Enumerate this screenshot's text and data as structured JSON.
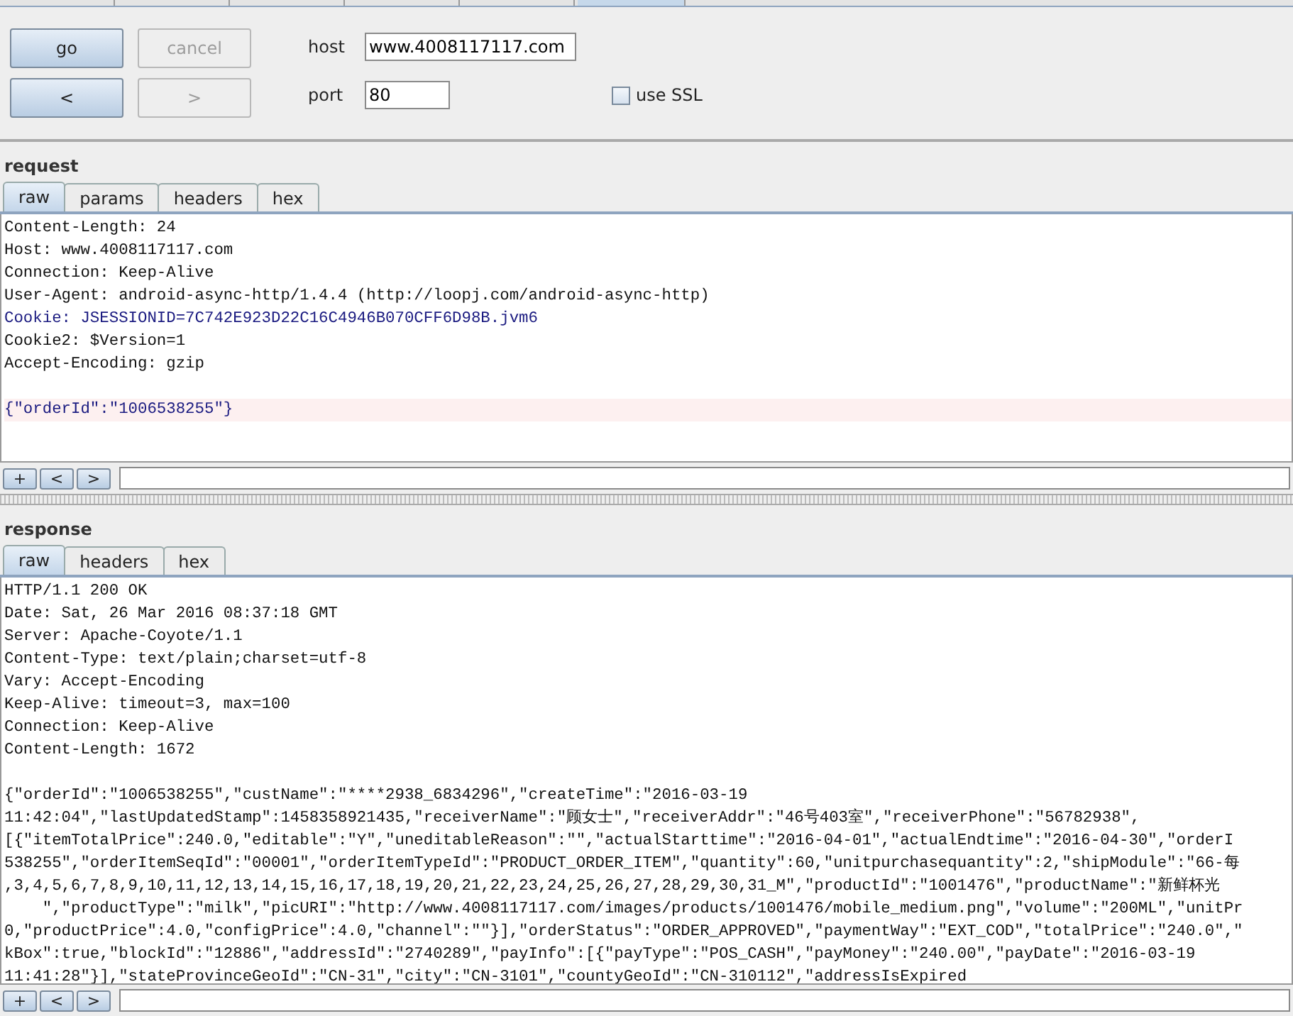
{
  "connection": {
    "buttons": [
      {
        "label": "go",
        "disabled": false
      },
      {
        "label": "cancel",
        "disabled": true
      },
      {
        "label": "<",
        "disabled": false
      },
      {
        "label": ">",
        "disabled": true
      }
    ],
    "host": {
      "label": "host",
      "value": "www.4008117117.com"
    },
    "port": {
      "label": "port",
      "value": "80"
    },
    "ssl": {
      "label": "use SSL",
      "checked": false
    }
  },
  "request": {
    "title": "request",
    "tabs": [
      {
        "label": "raw",
        "selected": true
      },
      {
        "label": "params",
        "selected": false
      },
      {
        "label": "headers",
        "selected": false
      },
      {
        "label": "hex",
        "selected": false
      }
    ],
    "lines": [
      {
        "text": "Content-Length: 24"
      },
      {
        "text": "Host: www.4008117117.com"
      },
      {
        "text": "Connection: Keep-Alive"
      },
      {
        "text": "User-Agent: android-async-http/1.4.4 (http://loopj.com/android-async-http)"
      },
      {
        "kind": "cookie",
        "text": "Cookie: JSESSIONID=7C742E923D22C16C4946B070CFF6D98B.jvm6"
      },
      {
        "text": "Cookie2: $Version=1"
      },
      {
        "text": "Accept-Encoding: gzip"
      },
      {
        "kind": "blank"
      },
      {
        "kind": "body",
        "text": "{\"orderId\":\"1006538255\"}"
      }
    ],
    "nav": [
      "+",
      "<",
      ">"
    ]
  },
  "response": {
    "title": "response",
    "tabs": [
      {
        "label": "raw",
        "selected": true
      },
      {
        "label": "headers",
        "selected": false
      },
      {
        "label": "hex",
        "selected": false
      }
    ],
    "lines": [
      {
        "text": "HTTP/1.1 200 OK"
      },
      {
        "text": "Date: Sat, 26 Mar 2016 08:37:18 GMT"
      },
      {
        "text": "Server: Apache-Coyote/1.1"
      },
      {
        "text": "Content-Type: text/plain;charset=utf-8"
      },
      {
        "text": "Vary: Accept-Encoding"
      },
      {
        "text": "Keep-Alive: timeout=3, max=100"
      },
      {
        "text": "Connection: Keep-Alive"
      },
      {
        "text": "Content-Length: 1672"
      },
      {
        "blank_before": true,
        "text": "{\"orderId\":\"1006538255\",\"custName\":\"****2938_6834296\",\"createTime\":\"2016-03-19"
      },
      {
        "text": "11:42:04\",\"lastUpdatedStamp\":1458358921435,\"receiverName\":\"顾女士\",\"receiverAddr\":\"46号403室\",\"receiverPhone\":\"56782938\","
      },
      {
        "text": "[{\"itemTotalPrice\":240.0,\"editable\":\"Y\",\"uneditableReason\":\"\",\"actualStarttime\":\"2016-04-01\",\"actualEndtime\":\"2016-04-30\",\"orderI"
      },
      {
        "text": "538255\",\"orderItemSeqId\":\"00001\",\"orderItemTypeId\":\"PRODUCT_ORDER_ITEM\",\"quantity\":60,\"unitpurchasequantity\":2,\"shipModule\":\"66-每"
      },
      {
        "text": ",3,4,5,6,7,8,9,10,11,12,13,14,15,16,17,18,19,20,21,22,23,24,25,26,27,28,29,30,31_M\",\"productId\":\"1001476\",\"productName\":\"新鲜杯光"
      },
      {
        "text": "    \",\"productType\":\"milk\",\"picURI\":\"http://www.4008117117.com/images/products/1001476/mobile_medium.png\",\"volume\":\"200ML\",\"unitPr"
      },
      {
        "text": "0,\"productPrice\":4.0,\"configPrice\":4.0,\"channel\":\"\"}],\"orderStatus\":\"ORDER_APPROVED\",\"paymentWay\":\"EXT_COD\",\"totalPrice\":\"240.0\",\""
      },
      {
        "text": "kBox\":true,\"blockId\":\"12886\",\"addressId\":\"2740289\",\"payInfo\":[{\"payType\":\"POS_CASH\",\"payMoney\":\"240.00\",\"payDate\":\"2016-03-19"
      },
      {
        "text": "11:41:28\"}],\"stateProvinceGeoId\":\"CN-31\",\"city\":\"CN-3101\",\"countyGeoId\":\"CN-310112\",\"addressIsExpired"
      }
    ],
    "nav": [
      "+",
      "<",
      ">"
    ]
  }
}
